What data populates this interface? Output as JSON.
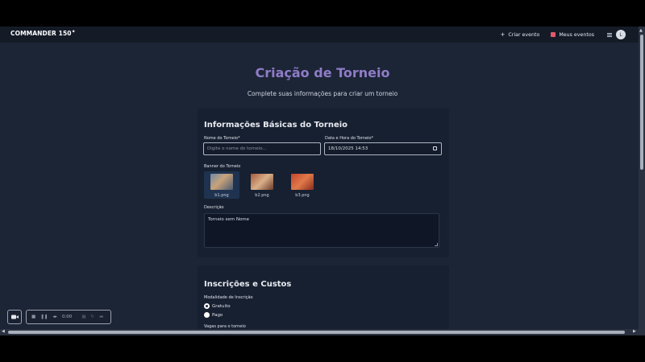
{
  "navbar": {
    "logo_text": "COMMANDER 150",
    "logo_mark": "✦",
    "create_event": "Criar evento",
    "my_events": "Meus eventos",
    "avatar_initial": "L"
  },
  "page": {
    "title": "Criação de Torneio",
    "subtitle": "Complete suas informações para criar um torneio"
  },
  "basic_info": {
    "title": "Informações Básicas do Torneio",
    "name_label": "Nome do Torneio*",
    "name_placeholder": "Digite o nome do torneio...",
    "date_label": "Data e Hora do Torneio*",
    "date_value": "18/10/2025 14:53",
    "banner_label": "Banner do Torneio",
    "banners": [
      {
        "file": "b1.png",
        "selected": true
      },
      {
        "file": "b2.png",
        "selected": false
      },
      {
        "file": "b3.png",
        "selected": false
      }
    ],
    "description_label": "Descrição",
    "description_value": "Torneio sem Nome"
  },
  "registration": {
    "title": "Inscrições e Custos",
    "mode_label": "Modalidade de Inscrição",
    "options": [
      {
        "label": "Gratuito",
        "checked": true
      },
      {
        "label": "Pago",
        "checked": false
      }
    ],
    "slots_label": "Vagas para o torneio"
  },
  "recorder": {
    "time": "0:00"
  }
}
